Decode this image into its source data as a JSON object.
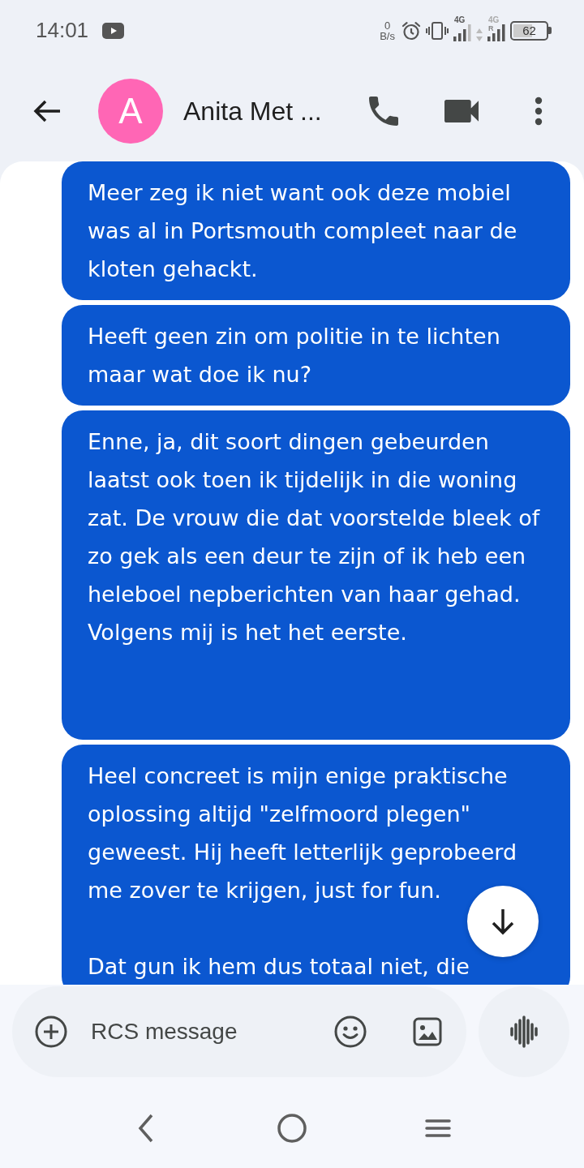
{
  "status_bar": {
    "time": "14:01",
    "net_speed": {
      "value": "0",
      "unit": "B/s"
    },
    "sim_1": {
      "network": "4G"
    },
    "sim_2": {
      "network": "4G",
      "roaming": "R"
    },
    "battery": "62"
  },
  "header": {
    "avatar_letter": "A",
    "contact_name": "Anita Met ..."
  },
  "messages": [
    {
      "text": "Meer zeg ik niet want ook deze mobiel was al in Portsmouth compleet naar de kloten gehackt."
    },
    {
      "text": "Heeft geen zin om politie in te lichten maar wat doe ik nu?"
    },
    {
      "text": "Enne, ja, dit soort dingen gebeurden laatst ook toen ik tijdelijk in die woning zat. De vrouw die dat voorstelde bleek of zo gek als een deur te zijn of ik heb een heleboel nepberichten van haar gehad. Volgens mij is het het eerste.\n\n\n"
    },
    {
      "text": "Heel concreet is mijn enige praktische oplossing altijd \"zelfmoord plegen\" geweest. Hij heeft letterlijk geprobeerd me zover te krijgen, just for fun.\n\nDat gun ik hem dus totaal niet, die"
    }
  ],
  "composer": {
    "placeholder": "RCS message"
  }
}
